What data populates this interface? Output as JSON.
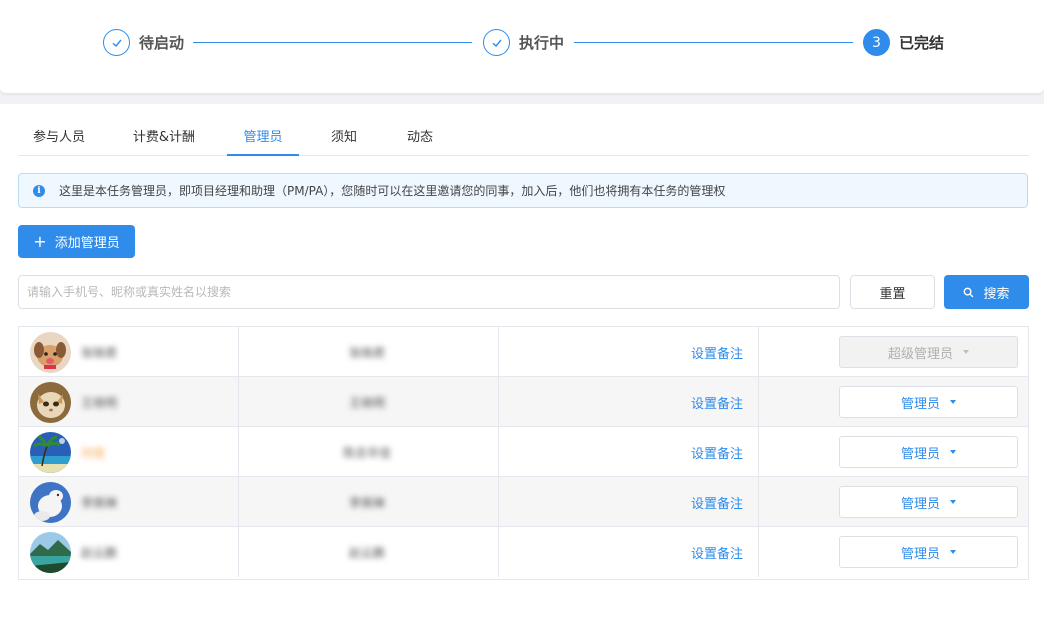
{
  "steps": [
    {
      "label": "待启动",
      "state": "done"
    },
    {
      "label": "执行中",
      "state": "done"
    },
    {
      "label": "已完结",
      "state": "active",
      "number": "3"
    }
  ],
  "tabs": [
    {
      "label": "参与人员"
    },
    {
      "label": "计费&计酬"
    },
    {
      "label": "管理员",
      "active": true
    },
    {
      "label": "须知"
    },
    {
      "label": "动态"
    }
  ],
  "alert": {
    "icon": "info-icon",
    "text": "这里是本任务管理员，即项目经理和助理（PM/PA），您随时可以在这里邀请您的同事，加入后，他们也将拥有本任务的管理权"
  },
  "add_button": {
    "label": "添加管理员"
  },
  "search": {
    "placeholder": "请输入手机号、昵称或真实姓名以搜索",
    "value": "",
    "reset_label": "重置",
    "search_label": "搜索"
  },
  "table": {
    "rows": [
      {
        "name": "张晓君",
        "account": "张晓君",
        "remark_label": "设置备注",
        "role": "超级管理员",
        "role_disabled": true,
        "avatar": "puppy-avatar"
      },
      {
        "name": "王晓明",
        "account": "王晓明",
        "remark_label": "设置备注",
        "role": "管理员",
        "role_disabled": false,
        "avatar": "cat-avatar"
      },
      {
        "name": "刘佳",
        "account": "陈志华佳",
        "remark_label": "设置备注",
        "role": "管理员",
        "role_disabled": false,
        "avatar": "beach-avatar",
        "name_color": "#f5a24a"
      },
      {
        "name": "李佩琳",
        "account": "李佩琳",
        "remark_label": "设置备注",
        "role": "管理员",
        "role_disabled": false,
        "avatar": "dog-avatar"
      },
      {
        "name": "赵云鹏",
        "account": "赵云鹏",
        "remark_label": "设置备注",
        "role": "管理员",
        "role_disabled": false,
        "avatar": "landscape-avatar"
      }
    ]
  },
  "colors": {
    "accent": "#2f8ceb",
    "alert_bg": "#f0f8ff",
    "row_alt": "#f6f6f6"
  }
}
